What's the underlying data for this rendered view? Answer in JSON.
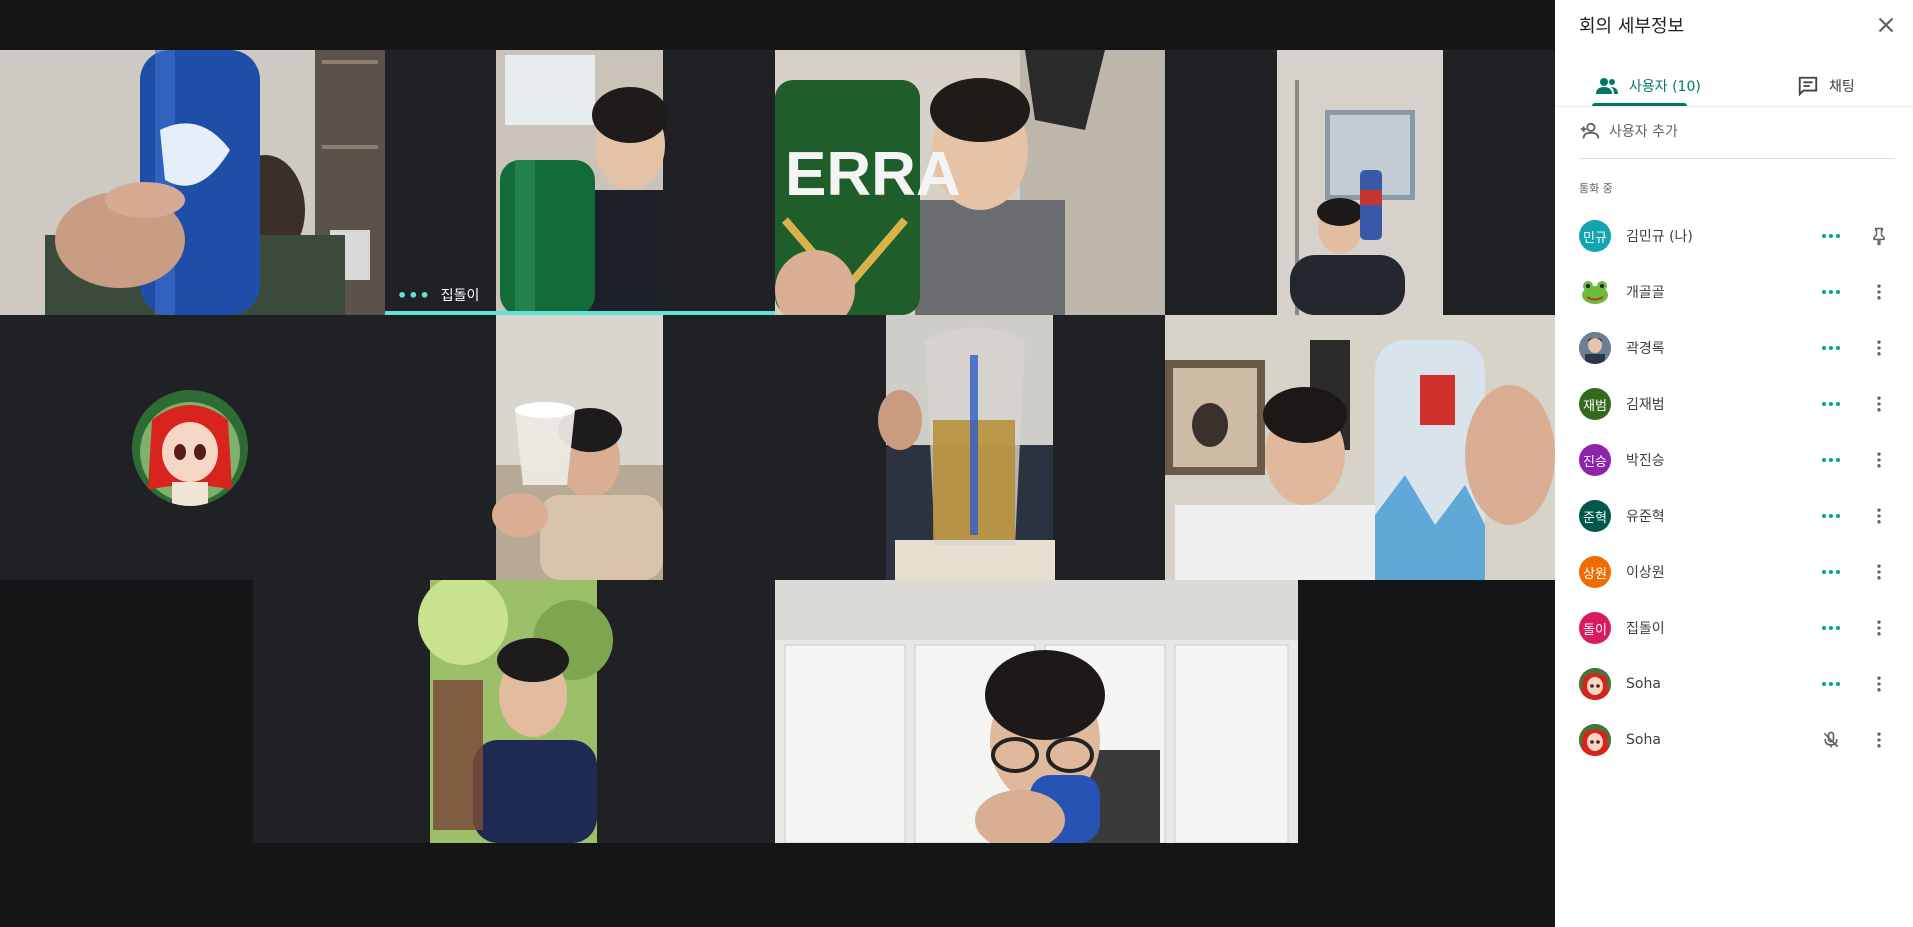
{
  "tiles": [
    {
      "id": "t1",
      "name": ""
    },
    {
      "id": "t2",
      "name": "집돌이",
      "speaking": true
    },
    {
      "id": "t3",
      "name": ""
    },
    {
      "id": "t4",
      "name": ""
    },
    {
      "id": "t5",
      "name": ""
    },
    {
      "id": "t6",
      "name": ""
    },
    {
      "id": "t7",
      "name": ""
    },
    {
      "id": "t8",
      "name": ""
    },
    {
      "id": "t9",
      "name": ""
    },
    {
      "id": "t10",
      "name": ""
    }
  ],
  "panel": {
    "title": "회의 세부정보",
    "tabs": {
      "people": "사용자 (10)",
      "chat": "채팅"
    },
    "add_user": "사용자 추가",
    "section_label": "통화 중",
    "participants": [
      {
        "name": "김민규 (나)",
        "initials": "민규",
        "color": "#12a4af",
        "action": "pin-icon"
      },
      {
        "name": "개골골",
        "initials": "",
        "color": "#ffffff",
        "action": "more-vert-icon"
      },
      {
        "name": "곽경록",
        "initials": "",
        "color": "#5a6b80",
        "action": "more-vert-icon"
      },
      {
        "name": "김재범",
        "initials": "재범",
        "color": "#33691e",
        "action": "more-vert-icon"
      },
      {
        "name": "박진승",
        "initials": "진승",
        "color": "#8e24aa",
        "action": "more-vert-icon"
      },
      {
        "name": "유준혁",
        "initials": "준혁",
        "color": "#00574b",
        "action": "more-vert-icon"
      },
      {
        "name": "이상원",
        "initials": "상원",
        "color": "#ef6c00",
        "action": "more-vert-icon"
      },
      {
        "name": "집돌이",
        "initials": "돌이",
        "color": "#d81b60",
        "action": "more-vert-icon"
      },
      {
        "name": "Soha",
        "initials": "",
        "color": "#c62828",
        "action": "more-vert-icon"
      },
      {
        "name": "Soha",
        "initials": "",
        "color": "#c62828",
        "action": "more-vert-icon",
        "muted": true
      }
    ]
  },
  "colors": {
    "accent": "#00796b",
    "speaking": "#5fe3d4",
    "stage": "#141516",
    "tile": "#202124"
  }
}
